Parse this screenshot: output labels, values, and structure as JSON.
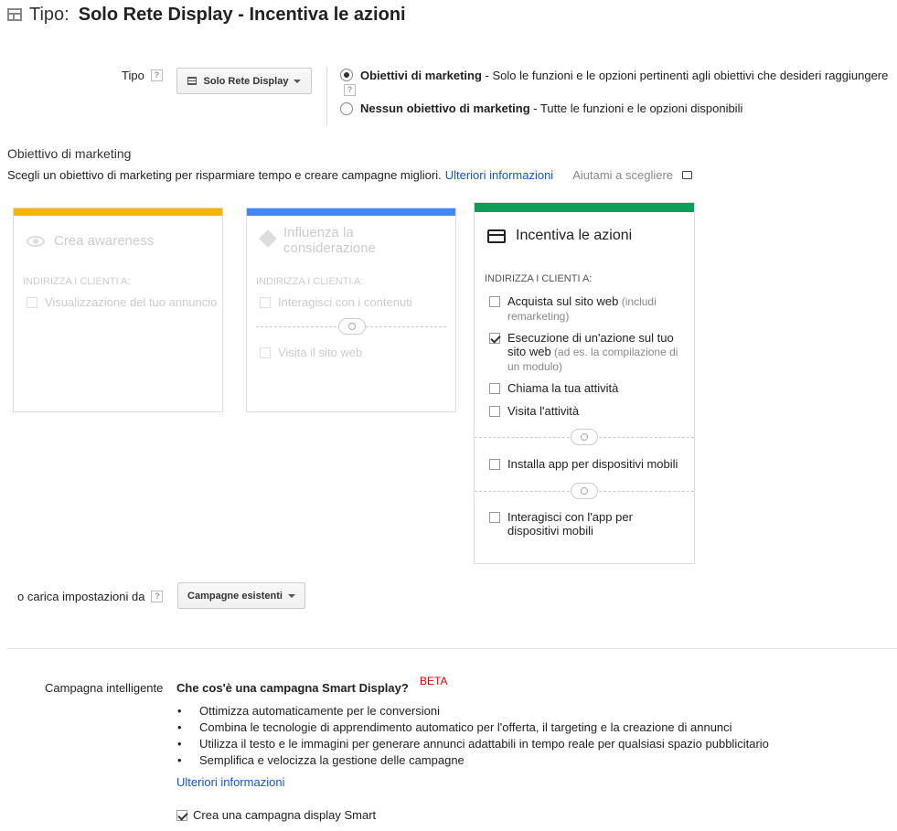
{
  "header": {
    "label": "Tipo:",
    "value": "Solo Rete Display - Incentiva le azioni"
  },
  "tipo": {
    "label": "Tipo",
    "help": "?",
    "dropdown_label": "Solo Rete Display",
    "options": [
      {
        "title": "Obiettivi di marketing",
        "desc": " - Solo le funzioni e le opzioni pertinenti agli obiettivi che desideri raggiungere",
        "selected": true
      },
      {
        "title": "Nessun obiettivo di marketing",
        "desc": " - Tutte le funzioni e le opzioni disponibili",
        "selected": false
      }
    ]
  },
  "marketing": {
    "heading": "Obiettivo di marketing",
    "intro": "Scegli un obiettivo di marketing per risparmiare tempo e creare campagne migliori.",
    "learn_more": "Ulteriori informazioni",
    "help_choose": "Aiutami a scegliere"
  },
  "cards": {
    "awareness": {
      "color": "#f4b400",
      "title": "Crea awareness",
      "target_label": "INDIRIZZA I CLIENTI A:",
      "opt1": "Visualizzazione del tuo annuncio"
    },
    "consideration": {
      "color": "#4285f4",
      "title": "Influenza la considerazione",
      "target_label": "INDIRIZZA I CLIENTI A:",
      "opt1": "Interagisci con i contenuti",
      "opt2": "Visita il sito web"
    },
    "action": {
      "color": "#0f9d58",
      "title": "Incentiva le azioni",
      "target_label": "INDIRIZZA I CLIENTI A:",
      "opt1_main": "Acquista sul sito web",
      "opt1_note": " (includi remarketing)",
      "opt2_main": "Esecuzione di un'azione sul tuo sito web",
      "opt2_note": " (ad es. la compilazione di un modulo)",
      "opt3": "Chiama la tua attività",
      "opt4": "Visita l'attività",
      "opt5": "Installa app per dispositivi mobili",
      "opt6": "Interagisci con l'app per dispositivi mobili"
    }
  },
  "load_settings": {
    "label": "o carica impostazioni da",
    "help": "?",
    "dropdown_label": "Campagne esistenti"
  },
  "smart": {
    "label": "Campagna intelligente",
    "question": "Che cos'è una campagna Smart Display?",
    "badge": "BETA",
    "bullets": [
      "Ottimizza automaticamente per le conversioni",
      "Combina le tecnologie di apprendimento automatico per l'offerta, il targeting e la creazione di annunci",
      "Utilizza il testo e le immagini per generare annunci adattabili in tempo reale per qualsiasi spazio pubblicitario",
      "Semplifica e velocizza la gestione delle campagne"
    ],
    "learn_more": "Ulteriori informazioni",
    "checkbox_label": "Crea una campagna display Smart"
  },
  "colors": {
    "link": "#1155cc",
    "beta": "#dd0000"
  }
}
